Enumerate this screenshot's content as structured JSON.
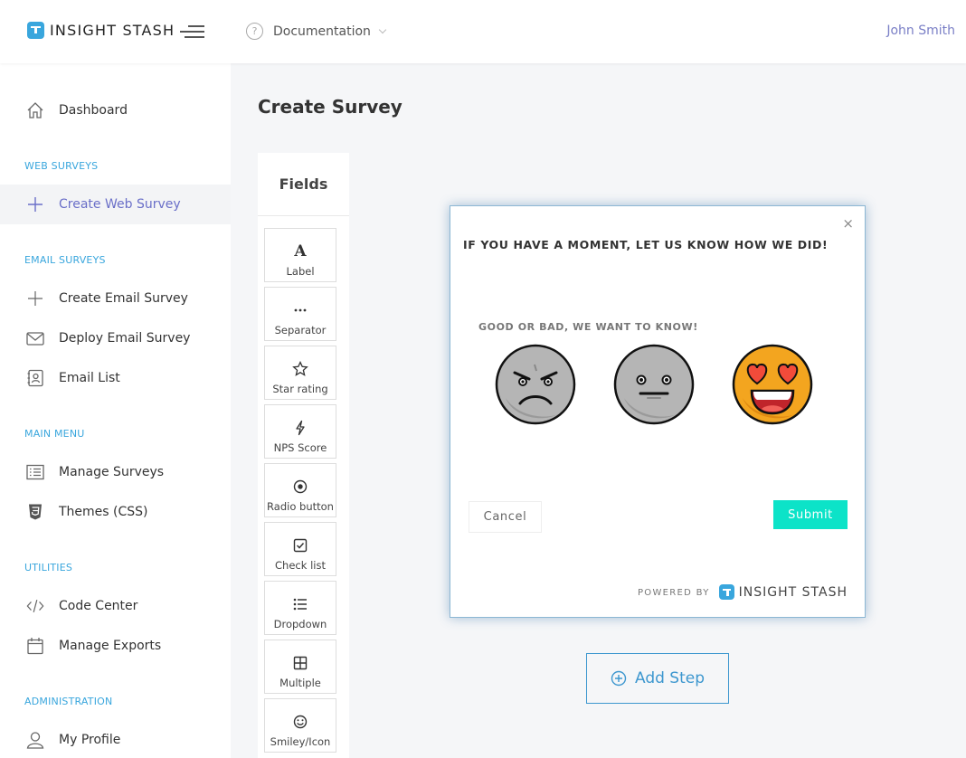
{
  "app": {
    "brand": "INSIGHT STASH",
    "docs_label": "Documentation",
    "user_name": "John Smith",
    "accent_color": "#39a6dd",
    "active_color": "#6a6fc8"
  },
  "sidebar": {
    "dashboard": "Dashboard",
    "sections": [
      {
        "heading": "WEB SURVEYS",
        "items": [
          {
            "label": "Create Web Survey",
            "icon": "plus-icon",
            "active": true
          }
        ]
      },
      {
        "heading": "EMAIL SURVEYS",
        "items": [
          {
            "label": "Create Email Survey",
            "icon": "plus-icon"
          },
          {
            "label": "Deploy Email Survey",
            "icon": "envelope-icon"
          },
          {
            "label": "Email List",
            "icon": "contacts-icon"
          }
        ]
      },
      {
        "heading": "MAIN MENU",
        "items": [
          {
            "label": "Manage Surveys",
            "icon": "list-icon"
          },
          {
            "label": "Themes (CSS)",
            "icon": "css3-icon"
          }
        ]
      },
      {
        "heading": "UTILITIES",
        "items": [
          {
            "label": "Code Center",
            "icon": "code-icon"
          },
          {
            "label": "Manage Exports",
            "icon": "calendar-icon"
          }
        ]
      },
      {
        "heading": "ADMINISTRATION",
        "items": [
          {
            "label": "My Profile",
            "icon": "user-icon"
          }
        ]
      }
    ]
  },
  "main": {
    "title": "Create Survey",
    "fields_heading": "Fields",
    "fields": [
      {
        "label": "Label",
        "icon": "letter-a-icon"
      },
      {
        "label": "Separator",
        "icon": "ellipsis-icon"
      },
      {
        "label": "Star rating",
        "icon": "star-icon"
      },
      {
        "label": "NPS Score",
        "icon": "bolt-icon"
      },
      {
        "label": "Radio button",
        "icon": "radio-icon"
      },
      {
        "label": "Check list",
        "icon": "checkbox-icon"
      },
      {
        "label": "Dropdown",
        "icon": "bullet-list-icon"
      },
      {
        "label": "Multiple",
        "icon": "grid-icon"
      },
      {
        "label": "Smiley/Icon",
        "icon": "smiley-icon"
      }
    ],
    "add_step": "Add Step"
  },
  "modal": {
    "close": "×",
    "title": "IF YOU HAVE A MOMENT, LET US KNOW HOW WE DID!",
    "subtitle": "GOOD OR BAD, WE WANT TO KNOW!",
    "options": [
      "angry-face-icon",
      "neutral-face-icon",
      "heart-eyes-face-icon"
    ],
    "cancel": "Cancel",
    "submit": "Submit",
    "powered_by": "POWERED BY",
    "brand": "INSIGHT STASH"
  }
}
